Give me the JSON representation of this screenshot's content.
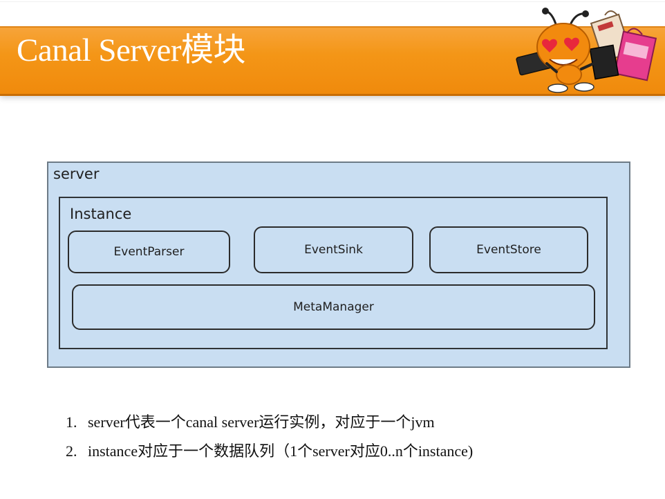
{
  "slide": {
    "title": "Canal Server模块",
    "mascot_icon": "ant-mascot-with-shopping-bags"
  },
  "diagram": {
    "server_label": "server",
    "instance_label": "Instance",
    "modules": {
      "parser": "EventParser",
      "sink": "EventSink",
      "store": "EventStore",
      "meta": "MetaManager"
    }
  },
  "notes": [
    {
      "num": "1.",
      "text": "server代表一个canal server运行实例，对应于一个jvm"
    },
    {
      "num": "2.",
      "text": "instance对应于一个数据队列（1个server对应0..n个instance)"
    }
  ],
  "colors": {
    "title_bar": "#f49617",
    "diagram_fill": "#c9def2"
  }
}
